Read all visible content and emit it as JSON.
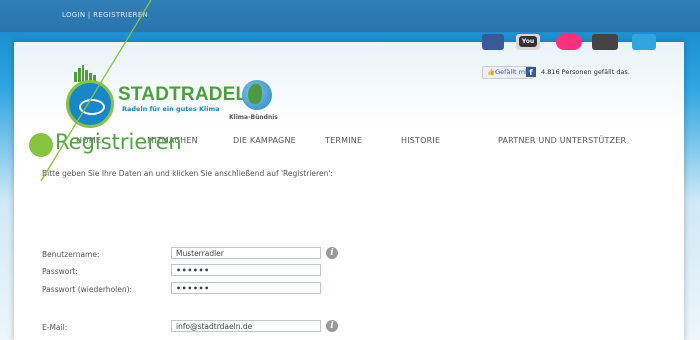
{
  "topbar": {
    "login": "LOGIN",
    "separator": "|",
    "register": "REGISTRIEREN"
  },
  "logo": {
    "title": "STADTRADELN",
    "subtitle": "Radeln für ein gutes Klima"
  },
  "partner": {
    "name": "Klima-Bündnis"
  },
  "social": {
    "youtube": "You",
    "like_button": "Gefällt mir",
    "fb": "f",
    "like_count": "4.816 Personen gefällt das."
  },
  "nav": [
    "HOME",
    "MITMACHEN",
    "DIE KAMPAGNE",
    "TERMINE",
    "HISTORIE",
    "PARTNER UND UNTERSTÜTZER"
  ],
  "page": {
    "title": "Registrieren",
    "intro": "Bitte geben Sie Ihre Daten an und klicken Sie anschließend auf 'Registrieren':"
  },
  "form": {
    "username_label": "Benutzername:",
    "username_value": "Musterradler",
    "password_label": "Passwort:",
    "password_value": "••••••",
    "password_repeat_label": "Passwort (wiederholen):",
    "password_repeat_value": "••••••",
    "email_label": "E-Mail:",
    "email_value": "info@stadtrdaeln.de",
    "info_glyph": "i"
  },
  "colors": {
    "accent_green": "#54a146",
    "brand_blue": "#1787c9",
    "annotation": "#86c440"
  },
  "icons": [
    "facebook-icon",
    "youtube-icon",
    "flickr-icon",
    "wordpress-icon",
    "twitter-icon",
    "info-icon"
  ]
}
